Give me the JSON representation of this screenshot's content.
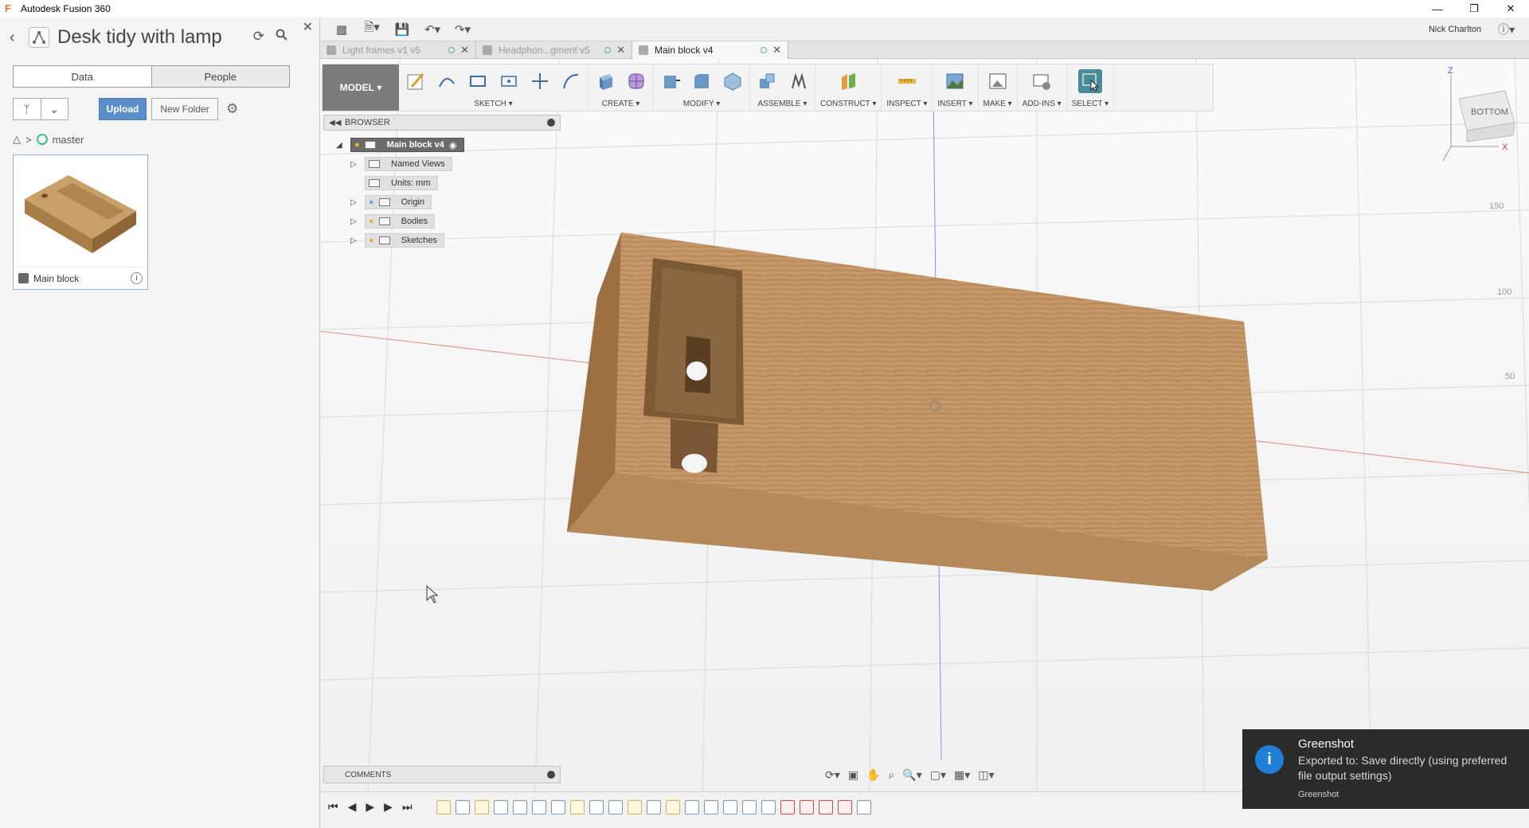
{
  "window": {
    "title": "Autodesk Fusion 360"
  },
  "data_panel": {
    "project_title": "Desk tidy with lamp",
    "tabs": [
      "Data",
      "People"
    ],
    "upload_label": "Upload",
    "new_folder_label": "New Folder",
    "branch": "master",
    "card": {
      "name": "Main block"
    }
  },
  "topbar": {
    "user": "Nick Charlton"
  },
  "doc_tabs": [
    {
      "label": "Light frames v1 v5"
    },
    {
      "label": "Headphon...gment v5"
    },
    {
      "label": "Main block v4"
    }
  ],
  "ribbon": {
    "mode": "MODEL",
    "groups": {
      "sketch": "SKETCH",
      "create": "CREATE",
      "modify": "MODIFY",
      "assemble": "ASSEMBLE",
      "construct": "CONSTRUCT",
      "inspect": "INSPECT",
      "insert": "INSERT",
      "make": "MAKE",
      "addins": "ADD-INS",
      "select": "SELECT"
    }
  },
  "browser": {
    "title": "BROWSER",
    "root": "Main block v4",
    "nodes": {
      "named_views": "Named Views",
      "units": "Units: mm",
      "origin": "Origin",
      "bodies": "Bodies",
      "sketches": "Sketches"
    }
  },
  "comments": {
    "label": "COMMENTS"
  },
  "viewcube": {
    "face": "BOTTOM",
    "axis_x": "X",
    "axis_z": "Z"
  },
  "ruler": {
    "ticks": [
      "150",
      "100",
      "50"
    ]
  },
  "toast": {
    "title": "Greenshot",
    "message": "Exported to: Save directly (using preferred file output settings)",
    "source": "Greenshot"
  },
  "colors": {
    "upload_button": "#5c8fc9",
    "wood": "#b98a55",
    "toast_bg": "#2b2b2b",
    "info_icon": "#1f7fd8"
  }
}
